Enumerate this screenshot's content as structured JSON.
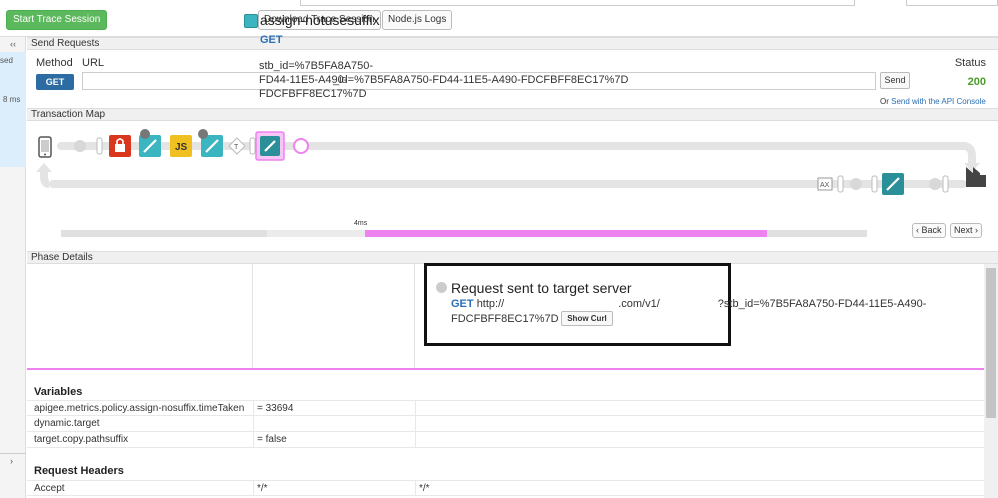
{
  "toolbar": {
    "start_trace": "Start Trace Session",
    "download_trace": "Download Trace Session",
    "node_logs": "Node.js Logs"
  },
  "sidebar": {
    "collapse": "‹‹",
    "expand": "›",
    "item_text": "sed",
    "item_time": "8 ms"
  },
  "send_requests": {
    "section_title": "Send Requests",
    "method_label": "Method",
    "url_label": "URL",
    "method_value": "GET",
    "url_value": "_id=%7B5FA8A750-FD44-11E5-A490-FDCFBFF8EC17%7D",
    "send_label": "Send",
    "status_label": "Status",
    "status_value": "200",
    "or_text": "Or",
    "api_console_link": "Send with the API Console"
  },
  "transaction_map": {
    "section_title": "Transaction Map",
    "js_label": "JS",
    "ax_label": "AX",
    "t_label": "T",
    "timeline_label": "4ms",
    "back_label": "‹ Back",
    "next_label": "Next ›"
  },
  "phase_details": {
    "section_title": "Phase Details",
    "policy_name": "assign-notusesuffix",
    "policy_method": "GET",
    "policy_url": "stb_id=%7B5FA8A750-FD44-11E5-A490-FDCFBFF8EC17%7D",
    "request_title": "Request sent to target server",
    "request_method": "GET",
    "request_url_start": "http://",
    "request_url_mid": ".com/v1/",
    "request_url_end": "?stb_id=%7B5FA8A750-FD44-11E5-A490-",
    "request_url_line2": "FDCFBFF8EC17%7D",
    "show_curl": "Show Curl"
  },
  "variables": {
    "title": "Variables",
    "rows": [
      {
        "key": "apigee.metrics.policy.assign-nosuffix.timeTaken",
        "value": "= 33694"
      },
      {
        "key": "dynamic.target",
        "value": ""
      },
      {
        "key": "target.copy.pathsuffix",
        "value": "= false"
      }
    ]
  },
  "request_headers": {
    "title": "Request Headers",
    "rows": [
      {
        "key": "Accept",
        "value": "*/*",
        "value2": "*/*"
      }
    ]
  },
  "colors": {
    "accent_blue": "#2d6ca2",
    "status_green": "#4a9a2a",
    "timeline_pink": "#ee82ee",
    "policy_teal": "#3bb5c0",
    "security_red": "#d9381e",
    "js_yellow": "#f0c020"
  }
}
